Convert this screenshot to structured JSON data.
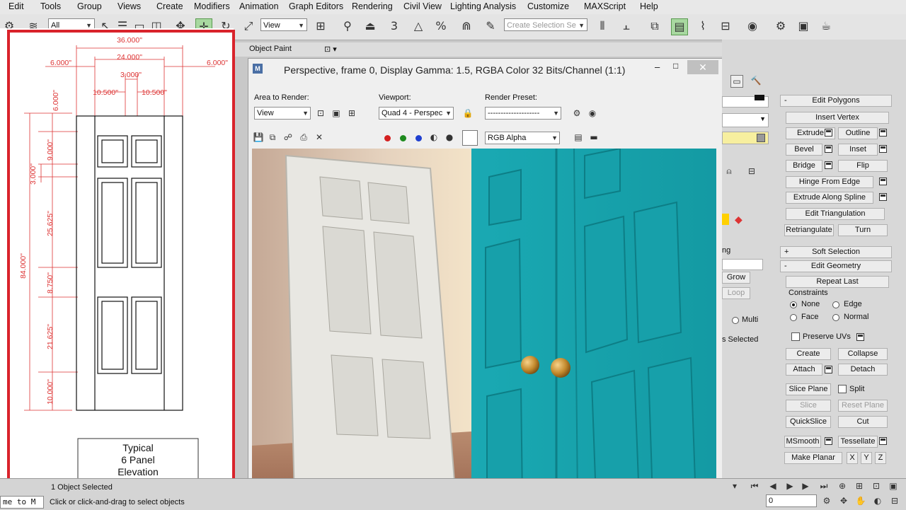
{
  "menu": [
    "Edit",
    "Tools",
    "Group",
    "Views",
    "Create",
    "Modifiers",
    "Animation",
    "Graph Editors",
    "Rendering",
    "Civil View",
    "Lighting Analysis",
    "Customize",
    "MAXScript",
    "Help"
  ],
  "toolbar": {
    "filter_value": "All",
    "coord_value": "View",
    "selection_set_placeholder": "Create Selection Se",
    "snap_label": "3",
    "percent_label": "%"
  },
  "left_panel": {
    "object_paint": "Object Paint"
  },
  "drawing": {
    "dims": {
      "overall_width": "36.000\"",
      "door_width": "24.000\"",
      "side_left": "6.000\"",
      "side_right": "6.000\"",
      "center_gap": "3.000\"",
      "panel_left": "10.500\"",
      "panel_right": "10.500\"",
      "top_rail": "6.000\"",
      "top_panel": "9.000\"",
      "rail_3": "3.000\"",
      "mid_panel": "25.625\"",
      "lock_rail": "8.750\"",
      "low_panel": "21.625\"",
      "bottom_rail": "10.000\"",
      "overall_height": "84.000\""
    },
    "caption": [
      "Typical",
      "6 Panel",
      "Elevation"
    ]
  },
  "render_window": {
    "title": "Perspective, frame 0, Display Gamma: 1.5, RGBA Color 32 Bits/Channel (1:1)",
    "area_label": "Area to Render:",
    "area_value": "View",
    "viewport_label": "Viewport:",
    "viewport_value": "Quad 4 - Perspec",
    "preset_label": "Render Preset:",
    "preset_value": "--------------------",
    "channel_value": "RGB Alpha",
    "colors": {
      "red": "#d42020",
      "green": "#1e8a1e",
      "blue": "#1f3fd0",
      "door_teal": "#1aa9b3",
      "door_white": "#e8e7e2"
    }
  },
  "right_panel": {
    "edit_polygons": "Edit Polygons",
    "insert_vertex": "Insert Vertex",
    "extrude": "Extrude",
    "outline": "Outline",
    "bevel": "Bevel",
    "inset": "Inset",
    "bridge": "Bridge",
    "flip": "Flip",
    "hinge_from_edge": "Hinge From Edge",
    "extrude_along_spline": "Extrude Along Spline",
    "edit_triangulation": "Edit Triangulation",
    "retriangulate": "Retriangulate",
    "turn": "Turn",
    "soft_selection": "Soft Selection",
    "edit_geometry": "Edit Geometry",
    "repeat_last": "Repeat Last",
    "constraints": "Constraints",
    "c_none": "None",
    "c_edge": "Edge",
    "c_face": "Face",
    "c_normal": "Normal",
    "preserve_uvs": "Preserve UVs",
    "create": "Create",
    "collapse": "Collapse",
    "attach": "Attach",
    "detach": "Detach",
    "slice_plane": "Slice Plane",
    "split": "Split",
    "slice": "Slice",
    "reset_plane": "Reset Plane",
    "quickslice": "QuickSlice",
    "cut": "Cut",
    "msmooth": "MSmooth",
    "tessellate": "Tessellate",
    "make_planar": "Make Planar",
    "x": "X",
    "y": "Y",
    "z": "Z",
    "grow": "Grow",
    "loop": "Loop",
    "multi": "Multi",
    "selected_text": "s Selected",
    "ng_text": "ng"
  },
  "status": {
    "left_text": "me to M",
    "object_selected": "1 Object Selected",
    "hint": "Click or click-and-drag to select objects",
    "frame_value": "0"
  }
}
